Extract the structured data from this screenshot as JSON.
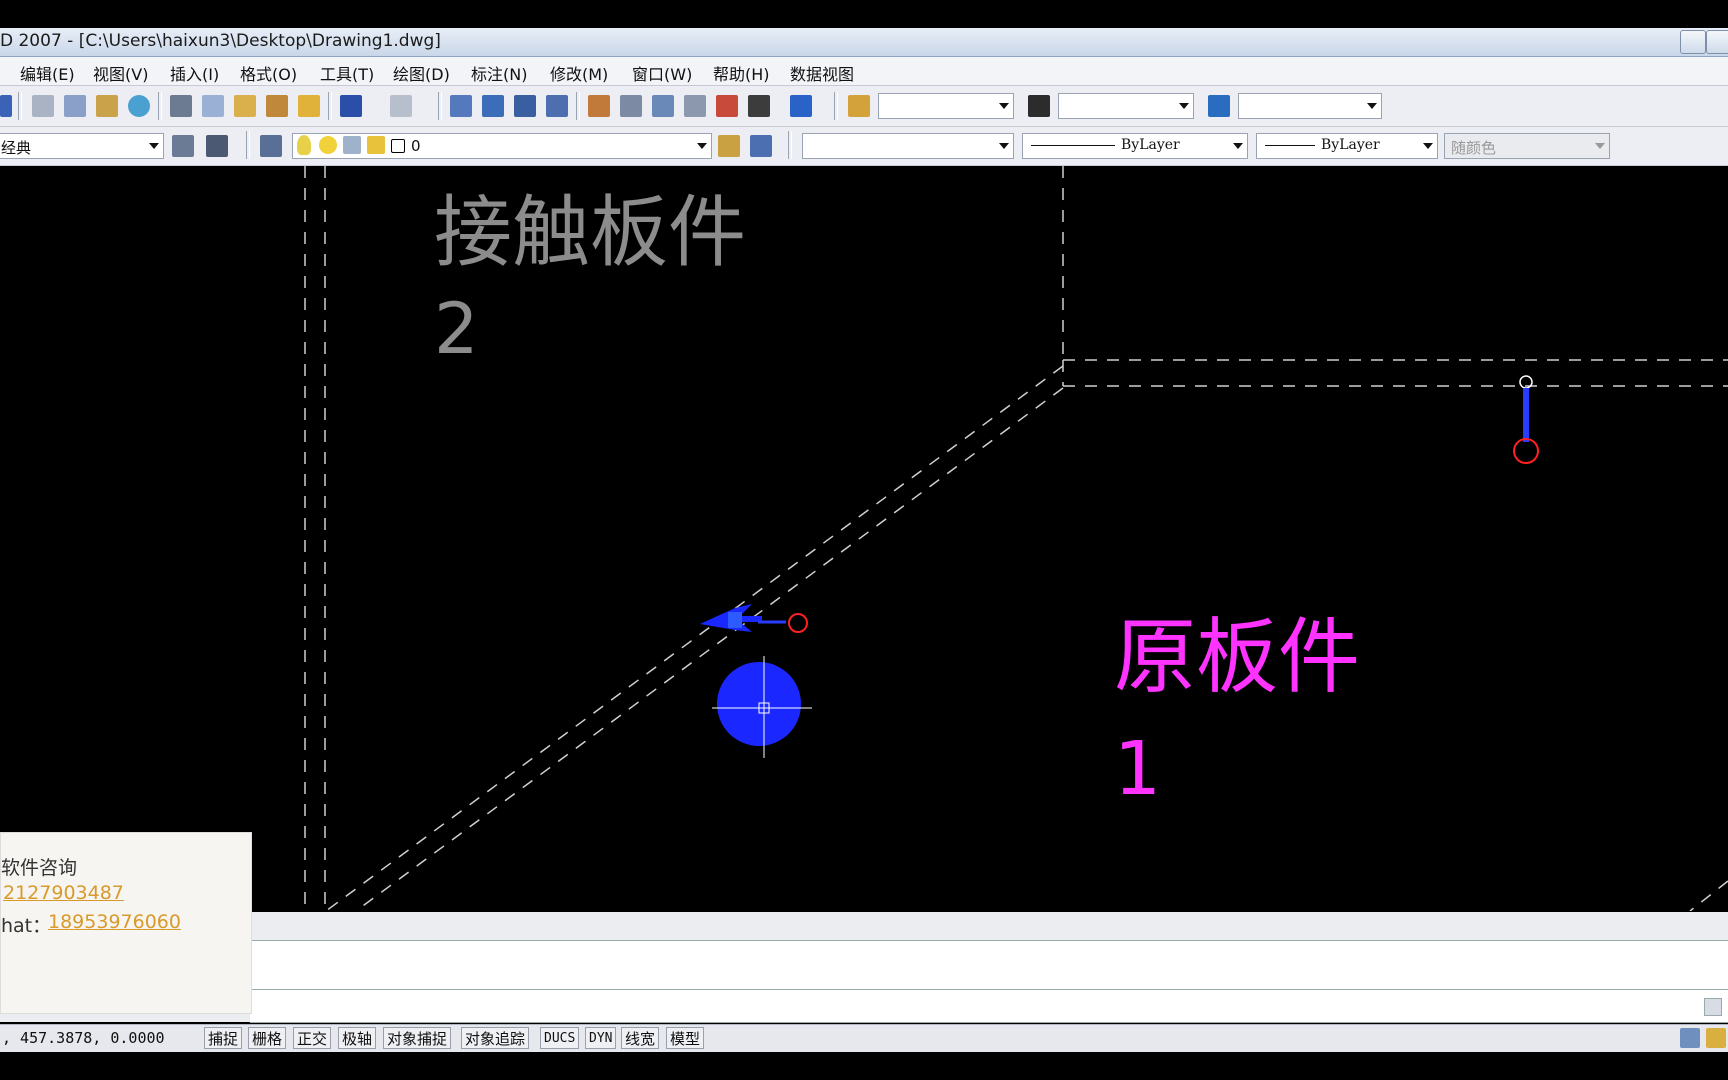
{
  "window": {
    "title": "D 2007 - [C:\\Users\\haixun3\\Desktop\\Drawing1.dwg]"
  },
  "menu": {
    "items": [
      "编辑(E)",
      "视图(V)",
      "插入(I)",
      "格式(O)",
      "工具(T)",
      "绘图(D)",
      "标注(N)",
      "修改(M)",
      "窗口(W)",
      "帮助(H)",
      "数据视图"
    ]
  },
  "toolbar2": {
    "workspace": "经典",
    "layer": "0",
    "linetype": "ByLayer",
    "lineweight": "ByLayer",
    "color": "随颜色"
  },
  "drawing": {
    "label_contact_line1": "接触板件",
    "label_contact_line2": "2",
    "label_original_line1": "原板件",
    "label_original_line2": "1",
    "colors": {
      "contact_label": "#8c8c8c",
      "original_label": "#ff33ff",
      "background": "#000000",
      "grip_blue": "#1a28ff",
      "marker_red": "#ff2020"
    }
  },
  "overlay": {
    "line1": "软件咨询",
    "qq_value": "2127903487",
    "wechat_prefix": "hat：",
    "wechat_value": "18953976060"
  },
  "status": {
    "coords": ", 457.3878,  0.0000",
    "buttons": [
      "捕捉",
      "栅格",
      "正交",
      "极轴",
      "对象捕捉",
      "对象追踪",
      "DUCS",
      "DYN",
      "线宽",
      "模型"
    ]
  }
}
